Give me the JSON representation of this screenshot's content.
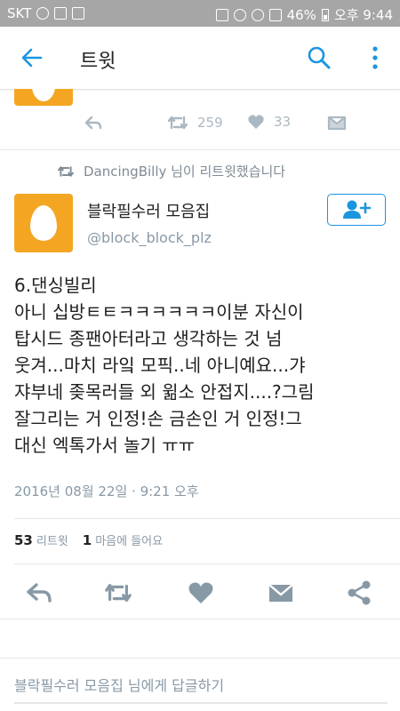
{
  "status_bar": {
    "carrier": "SKT",
    "battery": "46%",
    "time": "오후 9:44"
  },
  "app_bar": {
    "title": "트윗"
  },
  "previous_tweet": {
    "retweet_count": "259",
    "like_count": "33"
  },
  "retweet_notice": "DancingBilly 님이 리트윗했습니다",
  "tweet": {
    "display_name": "블락필수러 모음집",
    "handle": "@block_block_plz",
    "text": "6.댄싱빌리\n아니 십방ㅌㅌㅋㅋㅋㅋㅋㅋ이분 자신이\n탑시드 종팬아터라고 생각하는 것 넘\n웃겨...마치 라잌 모픽..네 아니예요...갸\n쟈부네 좆목러들 외 윎소 안접지....?그림\n잘그리는 거 인정!손 금손인 거 인정!그\n대신 엑톡가서 놀기 ㅠㅠ",
    "datetime": "2016년 08월 22일 · 9:21 오후",
    "retweet_count": "53",
    "retweet_label": "리트윗",
    "like_count": "1",
    "like_label": "마음에 들어요"
  },
  "reply_placeholder": "블락필수러 모음집 님에게 답글하기",
  "colors": {
    "accent": "#1b95e0",
    "avatar_bg": "#f4a623",
    "status_bar": "#a6a6a6",
    "muted": "#8899a6"
  }
}
